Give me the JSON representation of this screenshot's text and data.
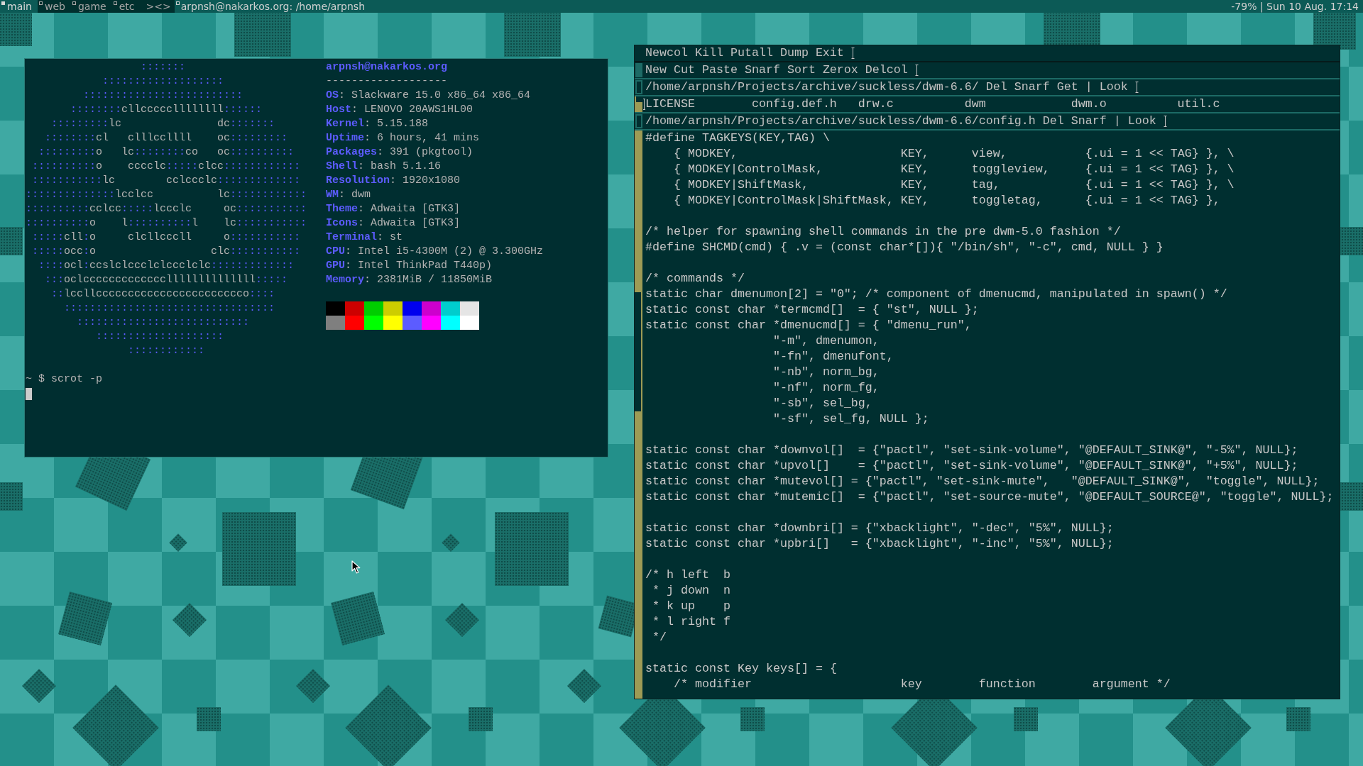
{
  "bar": {
    "tags": [
      {
        "label": "main",
        "selected": true,
        "occupied": true
      },
      {
        "label": "web",
        "selected": false,
        "occupied": true
      },
      {
        "label": "game",
        "selected": false,
        "occupied": true
      },
      {
        "label": "etc",
        "selected": false,
        "occupied": true
      }
    ],
    "layout": "><>",
    "title": "arpnsh@nakarkos.org: /home/arpnsh",
    "status": "-79% | Sun 10 Aug. 17:14"
  },
  "terminal": {
    "logo": [
      [
        {
          "text": "                  :::::::",
          "kind": "frame"
        }
      ],
      [
        {
          "text": "            :::::::::::::::::::",
          "kind": "frame"
        }
      ],
      [
        {
          "text": "         :::::::::::::::::::::::::",
          "kind": "frame"
        }
      ],
      [
        {
          "text": "       ::::::::",
          "kind": "frame"
        },
        {
          "text": "cllcccccllllllll",
          "kind": "letter"
        },
        {
          "text": "::::::",
          "kind": "frame"
        }
      ],
      [
        {
          "text": "    :::::::::",
          "kind": "frame"
        },
        {
          "text": "lc               dc",
          "kind": "letter"
        },
        {
          "text": ":::::::",
          "kind": "frame"
        }
      ],
      [
        {
          "text": "   ::::::::",
          "kind": "frame"
        },
        {
          "text": "cl   clllccllll    oc",
          "kind": "letter"
        },
        {
          "text": ":::::::::",
          "kind": "frame"
        }
      ],
      [
        {
          "text": "  :::::::::",
          "kind": "frame"
        },
        {
          "text": "o   lc",
          "kind": "letter"
        },
        {
          "text": "::::::::",
          "kind": "frame"
        },
        {
          "text": "co   oc",
          "kind": "letter"
        },
        {
          "text": "::::::::::",
          "kind": "frame"
        }
      ],
      [
        {
          "text": " ::::::::::",
          "kind": "frame"
        },
        {
          "text": "o    cccclc",
          "kind": "letter"
        },
        {
          "text": ":::::",
          "kind": "frame"
        },
        {
          "text": "clcc",
          "kind": "letter"
        },
        {
          "text": "::::::::::::",
          "kind": "frame"
        }
      ],
      [
        {
          "text": " :::::::::::",
          "kind": "frame"
        },
        {
          "text": "lc        cclccclc",
          "kind": "letter"
        },
        {
          "text": ":::::::::::::",
          "kind": "frame"
        }
      ],
      [
        {
          "text": "::::::::::::::",
          "kind": "frame"
        },
        {
          "text": "lcclcc          lc",
          "kind": "letter"
        },
        {
          "text": "::::::::::::",
          "kind": "frame"
        }
      ],
      [
        {
          "text": "::::::::::",
          "kind": "frame"
        },
        {
          "text": "cclcc",
          "kind": "letter"
        },
        {
          "text": ":::::",
          "kind": "frame"
        },
        {
          "text": "lccclc     oc",
          "kind": "letter"
        },
        {
          "text": ":::::::::::",
          "kind": "frame"
        }
      ],
      [
        {
          "text": "::::::::::",
          "kind": "frame"
        },
        {
          "text": "o    l",
          "kind": "letter"
        },
        {
          "text": "::::::::::",
          "kind": "frame"
        },
        {
          "text": "l    lc",
          "kind": "letter"
        },
        {
          "text": ":::::::::::",
          "kind": "frame"
        }
      ],
      [
        {
          "text": " :::::",
          "kind": "frame"
        },
        {
          "text": "cll",
          "kind": "letter"
        },
        {
          "text": ":",
          "kind": "frame"
        },
        {
          "text": "o     clcllcccll     o",
          "kind": "letter"
        },
        {
          "text": ":::::::::::",
          "kind": "frame"
        }
      ],
      [
        {
          "text": " :::::",
          "kind": "frame"
        },
        {
          "text": "occ",
          "kind": "letter"
        },
        {
          "text": ":",
          "kind": "frame"
        },
        {
          "text": "o                  clc",
          "kind": "letter"
        },
        {
          "text": ":::::::::::",
          "kind": "frame"
        }
      ],
      [
        {
          "text": "  ::::",
          "kind": "frame"
        },
        {
          "text": "ocl",
          "kind": "letter"
        },
        {
          "text": ":",
          "kind": "frame"
        },
        {
          "text": "ccslclccclclccclclc",
          "kind": "letter"
        },
        {
          "text": ":::::::::::::",
          "kind": "frame"
        }
      ],
      [
        {
          "text": "   :::",
          "kind": "frame"
        },
        {
          "text": "oclcccccccccccccllllllllllllll",
          "kind": "letter"
        },
        {
          "text": ":::::",
          "kind": "frame"
        }
      ],
      [
        {
          "text": "    ::",
          "kind": "frame"
        },
        {
          "text": "lccllccccccccccccccccccccccco",
          "kind": "letter"
        },
        {
          "text": "::::",
          "kind": "frame"
        }
      ],
      [
        {
          "text": "      :::::::::::::::::::::::::::::::::",
          "kind": "frame"
        }
      ],
      [
        {
          "text": "        :::::::::::::::::::::::::::",
          "kind": "frame"
        }
      ],
      [
        {
          "text": "           ::::::::::::::::::::",
          "kind": "frame"
        }
      ],
      [
        {
          "text": "                ::::::::::::",
          "kind": "frame"
        }
      ]
    ],
    "info": {
      "title": "arpnsh@nakarkos.org",
      "rule": "-------------------",
      "fields": [
        "**OS**: Slackware 15.0 x86_64 x86_64",
        "**Host**: LENOVO 20AWS1HL00",
        "**Kernel**: 5.15.188",
        "**Uptime**: 6 hours, 41 mins",
        "**Packages**: 391 (pkgtool)",
        "**Shell**: bash 5.1.16",
        "**Resolution**: 1920x1080",
        "**WM**: dwm",
        "**Theme**: Adwaita [GTK3]",
        "**Icons**: Adwaita [GTK3]",
        "**Terminal**: st",
        "**CPU**: Intel i5-4300M (2) @ 3.300GHz",
        "**GPU**: Intel ThinkPad T440p)",
        "**Memory**: 2381MiB / 11850MiB"
      ]
    },
    "palette": [
      [
        {
          "color": "#000000"
        },
        {
          "color": "#cd0000"
        },
        {
          "color": "#00cd00"
        },
        {
          "color": "#cdcd00"
        },
        {
          "color": "#0000ee"
        },
        {
          "color": "#cd00cd"
        },
        {
          "color": "#00cdcd"
        },
        {
          "color": "#e5e5e5"
        }
      ],
      [
        {
          "color": "#7f7f7f"
        },
        {
          "color": "#ff0000"
        },
        {
          "color": "#00ff00"
        },
        {
          "color": "#ffff00"
        },
        {
          "color": "#5c5cff"
        },
        {
          "color": "#ff00ff"
        },
        {
          "color": "#00ffff"
        },
        {
          "color": "#ffffff"
        }
      ]
    ],
    "prompt": "~ $ scrot -p"
  },
  "acme": {
    "row_tag": [
      "Newcol",
      "Kill",
      "Putall",
      "Dump",
      "Exit"
    ],
    "column_tag": [
      "New",
      "Cut",
      "Paste",
      "Snarf",
      "Sort",
      "Zerox",
      "Delcol"
    ],
    "windows": [
      {
        "kind": "directory",
        "tag": {
          "path": "/home/arpnsh/Projects/archive/suckless/dwm-6.6/",
          "commands": [
            "Del",
            "Snarf",
            "Get"
          ],
          "separator": "|",
          "extra": [
            "Look"
          ]
        },
        "files": [
          "LICENSE",
          "config.def.h",
          "drw.c",
          "dwm",
          "dwm.o",
          "util.c"
        ]
      },
      {
        "kind": "file",
        "tag": {
          "path": "/home/arpnsh/Projects/archive/suckless/dwm-6.6/config.h",
          "commands": [
            "Del",
            "Snarf"
          ],
          "separator": "|",
          "extra": [
            "Look"
          ]
        },
        "blocks": [
          [
            "#define TAGKEYS(KEY,TAG) \\",
            "    { MODKEY,                       KEY,      view,           {.ui = 1 << TAG} }, \\",
            "    { MODKEY|ControlMask,           KEY,      toggleview,     {.ui = 1 << TAG} }, \\",
            "    { MODKEY|ShiftMask,             KEY,      tag,            {.ui = 1 << TAG} }, \\",
            "    { MODKEY|ControlMask|ShiftMask, KEY,      toggletag,      {.ui = 1 << TAG} },"
          ],
          [
            "/* helper for spawning shell commands in the pre dwm-5.0 fashion */",
            "#define SHCMD(cmd) { .v = (const char*[]){ \"/bin/sh\", \"-c\", cmd, NULL } }"
          ],
          [
            "/* commands */",
            "static char dmenumon[2] = \"0\"; /* component of dmenucmd, manipulated in spawn() */",
            "static const char *termcmd[]  = { \"st\", NULL };",
            "static const char *dmenucmd[] = { \"dmenu_run\",",
            "                  \"-m\", dmenumon,",
            "                  \"-fn\", dmenufont,",
            "                  \"-nb\", norm_bg,",
            "                  \"-nf\", norm_fg,",
            "                  \"-sb\", sel_bg,",
            "                  \"-sf\", sel_fg, NULL };"
          ],
          [
            "static const char *downvol[]  = {\"pactl\", \"set-sink-volume\", \"@DEFAULT_SINK@\", \"-5%\", NULL};",
            "static const char *upvol[]    = {\"pactl\", \"set-sink-volume\", \"@DEFAULT_SINK@\", \"+5%\", NULL};",
            "static const char *mutevol[] = {\"pactl\", \"set-sink-mute\",   \"@DEFAULT_SINK@\",  \"toggle\", NULL};",
            "static const char *mutemic[]  = {\"pactl\", \"set-source-mute\", \"@DEFAULT_SOURCE@\", \"toggle\", NULL};"
          ],
          [
            "static const char *downbri[] = {\"xbacklight\", \"-dec\", \"5%\", NULL};",
            "static const char *upbri[]   = {\"xbacklight\", \"-inc\", \"5%\", NULL};"
          ],
          [
            "/* h left  b",
            " * j down  n",
            " * k up    p",
            " * l right f",
            " */"
          ],
          [
            "static const Key keys[] = {",
            "    /* modifier                     key        function        argument */"
          ]
        ]
      }
    ]
  }
}
